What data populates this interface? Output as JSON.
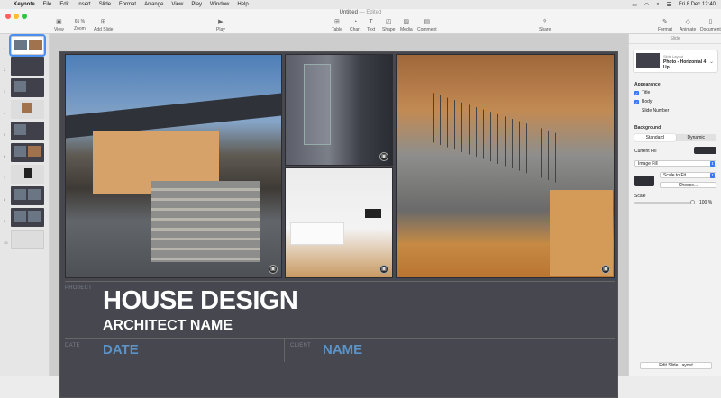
{
  "menubar": {
    "app": "Keynote",
    "items": [
      "File",
      "Edit",
      "Insert",
      "Slide",
      "Format",
      "Arrange",
      "View",
      "Play",
      "Window",
      "Help"
    ],
    "datetime": "Fri 8 Dec  12:40"
  },
  "window": {
    "title": "Untitled",
    "status": "— Edited"
  },
  "toolbar": {
    "view": "View",
    "zoom_value": "65 %",
    "zoom": "Zoom",
    "add_slide": "Add Slide",
    "play": "Play",
    "table": "Table",
    "chart": "Chart",
    "text": "Text",
    "shape": "Shape",
    "media": "Media",
    "comment": "Comment",
    "share": "Share",
    "format": "Format",
    "animate": "Animate",
    "document": "Document"
  },
  "navigator": {
    "slides": [
      "1",
      "2",
      "3",
      "4",
      "5",
      "6",
      "7",
      "8",
      "9",
      "10"
    ]
  },
  "slide": {
    "project_label": "PROJECT",
    "title": "HOUSE DESIGN",
    "subtitle": "ARCHITECT NAME",
    "date_label": "DATE",
    "date_value": "DATE",
    "client_label": "CLIENT",
    "client_value": "NAME"
  },
  "sidebar": {
    "tab": "Slide",
    "layout_small": "Slide Layout",
    "layout_name": "Photo - Horizontal 4 Up",
    "appearance": "Appearance",
    "title_opt": "Title",
    "body_opt": "Body",
    "slide_number_opt": "Slide Number",
    "background": "Background",
    "standard": "Standard",
    "dynamic": "Dynamic",
    "current_fill": "Current Fill",
    "fill_type": "Image Fill",
    "scale": "Scale to Fit",
    "choose": "Choose...",
    "scale_label": "Scale",
    "scale_value": "100 %",
    "edit_layout": "Edit Slide Layout"
  },
  "colors": {
    "accent": "#3478f6",
    "slide_bg": "#46474f",
    "title_blue": "#5b93c8"
  }
}
